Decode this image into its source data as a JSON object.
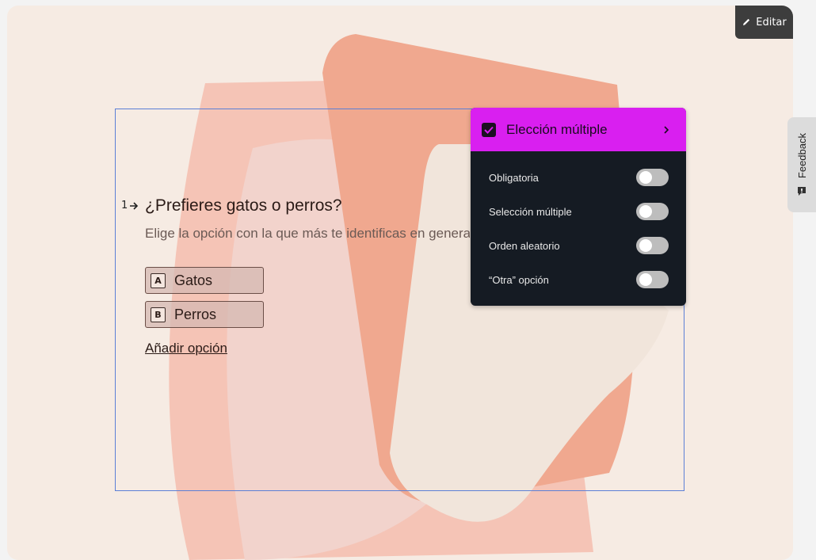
{
  "toolbar": {
    "edit_label": "Editar"
  },
  "feedback": {
    "label": "Feedback"
  },
  "question": {
    "number": "1",
    "title": "¿Prefieres gatos o perros?",
    "description": "Elige la opción con la que más te identificas en general",
    "choices": [
      {
        "key": "A",
        "label": "Gatos"
      },
      {
        "key": "B",
        "label": "Perros"
      }
    ],
    "add_option_label": "Añadir opción"
  },
  "settings_panel": {
    "title": "Elección múltiple",
    "accent_color": "#d91ff0",
    "options": [
      {
        "label": "Obligatoria",
        "enabled": false
      },
      {
        "label": "Selección múltiple",
        "enabled": false
      },
      {
        "label": "Orden aleatorio",
        "enabled": false
      },
      {
        "label": "“Otra” opción",
        "enabled": false
      }
    ]
  }
}
